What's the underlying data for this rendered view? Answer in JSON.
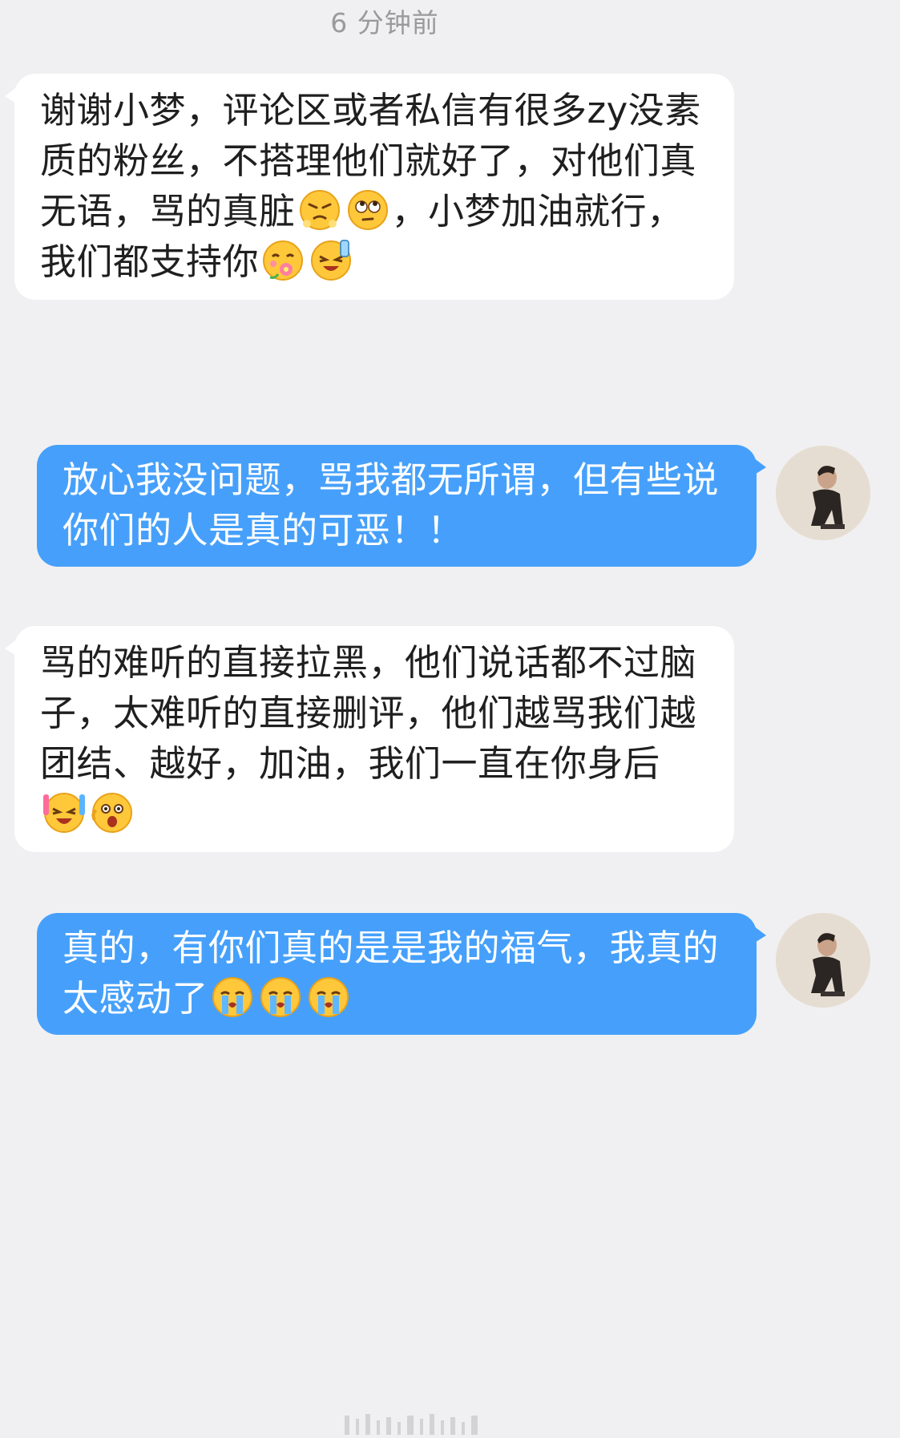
{
  "timestamp": "6 分钟前",
  "messages": [
    {
      "side": "left",
      "segments": [
        {
          "type": "text",
          "value": "谢谢小梦，评论区或者私信有很多zy没素质的粉丝，不搭理他们就好了，对他们真无语，骂的真脏"
        },
        {
          "type": "emoji",
          "name": "angry-face-emoji"
        },
        {
          "type": "emoji",
          "name": "eye-roll-face-emoji"
        },
        {
          "type": "text",
          "value": "，小梦加油就行，我们都支持你"
        },
        {
          "type": "emoji",
          "name": "flower-face-emoji"
        },
        {
          "type": "emoji",
          "name": "cheer-face-emoji"
        }
      ]
    },
    {
      "side": "right",
      "segments": [
        {
          "type": "text",
          "value": "放心我没问题，骂我都无所谓，但有些说你们的人是真的可恶！！"
        }
      ]
    },
    {
      "side": "left",
      "segments": [
        {
          "type": "text",
          "value": "骂的难听的直接拉黑，他们说话都不过脑子，太难听的直接删评，他们越骂我们越团结、越好，加油，我们一直在你身后"
        },
        {
          "type": "emoji",
          "name": "glowstick-face-emoji"
        },
        {
          "type": "emoji",
          "name": "excited-face-emoji"
        }
      ]
    },
    {
      "side": "right",
      "segments": [
        {
          "type": "text",
          "value": "真的，有你们真的是是我的福气，我真的太感动了"
        },
        {
          "type": "emoji",
          "name": "crying-face-emoji"
        },
        {
          "type": "emoji",
          "name": "crying-face-emoji"
        },
        {
          "type": "emoji",
          "name": "crying-face-emoji"
        }
      ]
    }
  ],
  "colors": {
    "background": "#f0f0f2",
    "left_bubble": "#ffffff",
    "right_bubble": "#46a0fb",
    "timestamp_text": "#9a9a9a"
  }
}
